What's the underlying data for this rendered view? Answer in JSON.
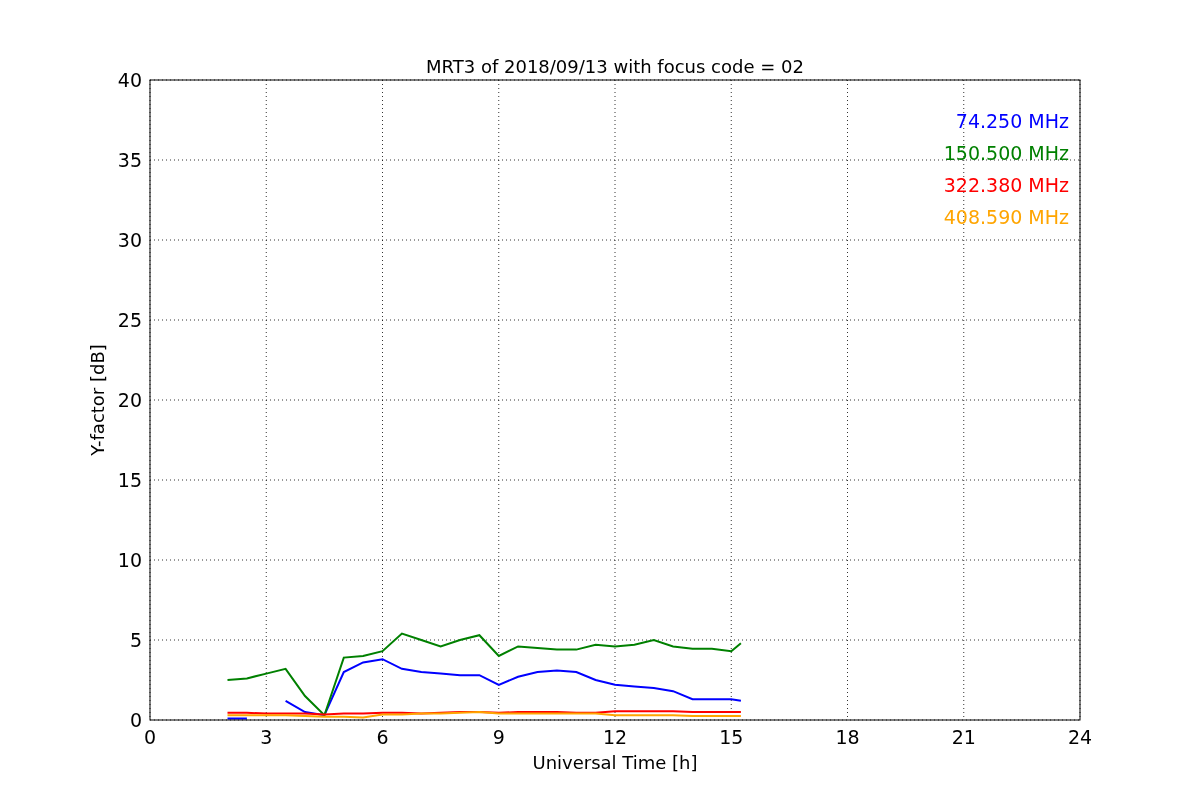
{
  "chart_data": {
    "type": "line",
    "title": "MRT3 of 2018/09/13 with focus code = 02",
    "xlabel": "Universal Time [h]",
    "ylabel": "Y-factor [dB]",
    "x": [
      2,
      2.5,
      3,
      3.5,
      4,
      4.5,
      5,
      5.5,
      6,
      6.5,
      7,
      7.5,
      8,
      8.5,
      9,
      9.5,
      10,
      10.5,
      11,
      11.5,
      12,
      12.5,
      13,
      13.5,
      14,
      14.5,
      15,
      15.25
    ],
    "series": [
      {
        "name": "74.250 MHz",
        "color": "#0000ff",
        "values": [
          0.1,
          0.1,
          null,
          1.2,
          0.5,
          0.3,
          3.0,
          3.6,
          3.8,
          3.2,
          3.0,
          2.9,
          2.8,
          2.8,
          2.2,
          2.7,
          3.0,
          3.1,
          3.0,
          2.5,
          2.2,
          2.1,
          2.0,
          1.8,
          1.3,
          1.3,
          1.3,
          1.2
        ]
      },
      {
        "name": "150.500 MHz",
        "color": "#008000",
        "values": [
          2.5,
          2.6,
          2.9,
          3.2,
          1.5,
          0.3,
          3.9,
          4.0,
          4.3,
          5.4,
          5.0,
          4.6,
          5.0,
          5.3,
          4.0,
          4.6,
          4.5,
          4.4,
          4.4,
          4.7,
          4.6,
          4.7,
          5.0,
          4.6,
          4.45,
          4.45,
          4.3,
          4.8
        ]
      },
      {
        "name": "322.380 MHz",
        "color": "#ff0000",
        "values": [
          0.45,
          0.45,
          0.4,
          0.4,
          0.4,
          0.35,
          0.4,
          0.4,
          0.45,
          0.45,
          0.4,
          0.45,
          0.5,
          0.5,
          0.45,
          0.5,
          0.5,
          0.5,
          0.45,
          0.45,
          0.55,
          0.55,
          0.55,
          0.55,
          0.5,
          0.5,
          0.5,
          0.5
        ]
      },
      {
        "name": "408.590 MHz",
        "color": "#ffa500",
        "values": [
          0.3,
          0.3,
          0.3,
          0.3,
          0.25,
          0.2,
          0.2,
          0.15,
          0.35,
          0.35,
          0.4,
          0.4,
          0.45,
          0.5,
          0.4,
          0.4,
          0.4,
          0.4,
          0.4,
          0.4,
          0.3,
          0.3,
          0.3,
          0.3,
          0.25,
          0.25,
          0.25,
          0.25
        ]
      }
    ],
    "xlim": [
      0,
      24
    ],
    "ylim": [
      0,
      40
    ],
    "xticks": [
      0,
      3,
      6,
      9,
      12,
      15,
      18,
      21,
      24
    ],
    "yticks": [
      0,
      5,
      10,
      15,
      20,
      25,
      30,
      35,
      40
    ],
    "grid": true
  }
}
